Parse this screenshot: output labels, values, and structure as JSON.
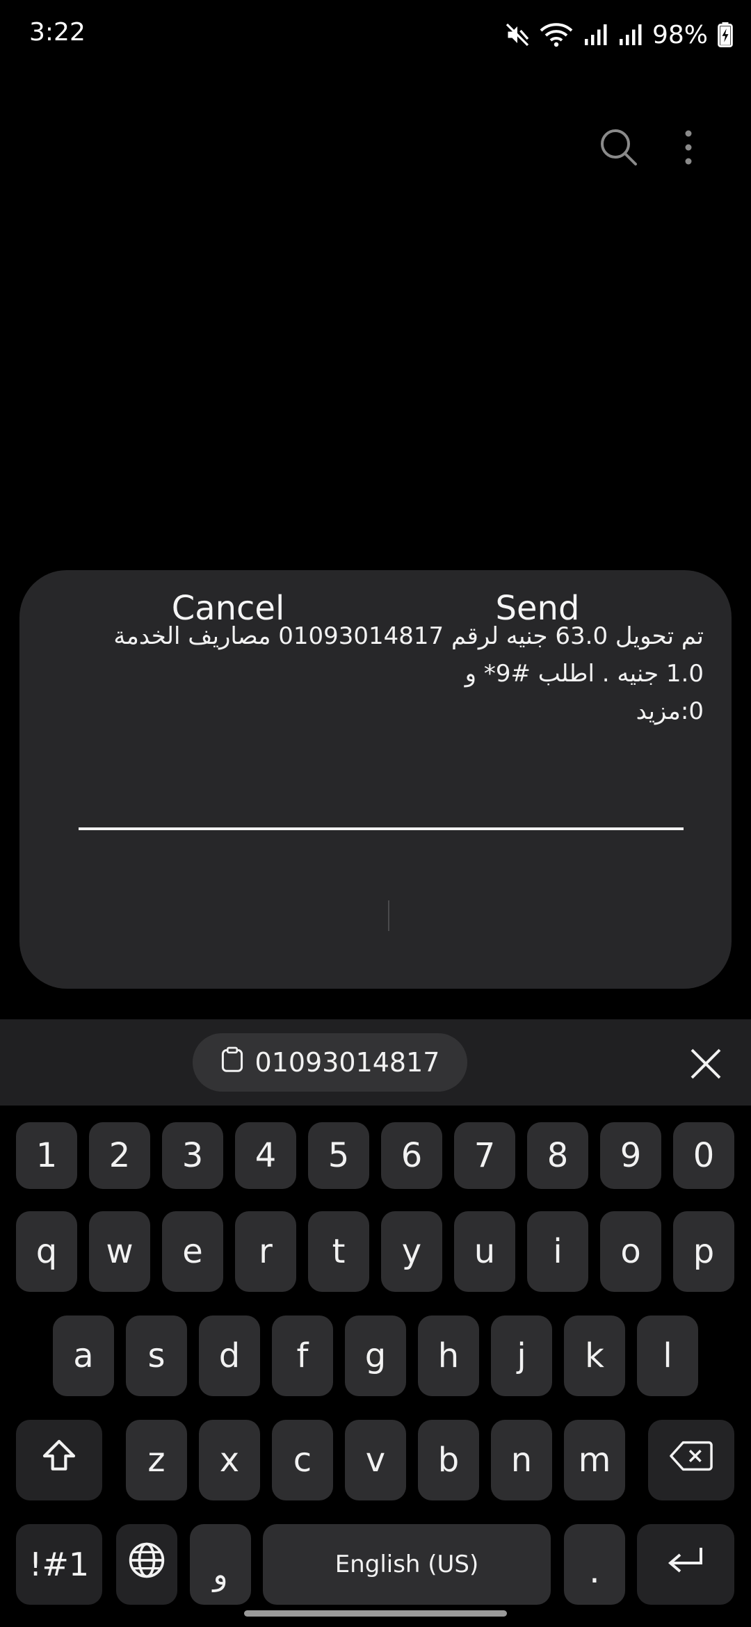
{
  "status_bar": {
    "time": "3:22",
    "battery": "98%",
    "icons": [
      "mute-icon",
      "wifi-icon",
      "signal-icon",
      "signal-icon",
      "battery-charging-icon"
    ]
  },
  "app_bar": {
    "icons": [
      "search-icon",
      "more-vertical-icon"
    ]
  },
  "dialog": {
    "message": "تم تحويل 63.0 جنيه لرقم 01093014817 مصاريف الخدمة 1.0 جنيه . اطلب #9* و\n0:مزيد",
    "cancel_label": "Cancel",
    "send_label": "Send"
  },
  "keyboard": {
    "clipboard_text": "01093014817",
    "number_row": [
      "1",
      "2",
      "3",
      "4",
      "5",
      "6",
      "7",
      "8",
      "9",
      "0"
    ],
    "row1": [
      "q",
      "w",
      "e",
      "r",
      "t",
      "y",
      "u",
      "i",
      "o",
      "p"
    ],
    "row2": [
      "a",
      "s",
      "d",
      "f",
      "g",
      "h",
      "j",
      "k",
      "l"
    ],
    "row3": [
      "z",
      "x",
      "c",
      "v",
      "b",
      "n",
      "m"
    ],
    "symbols_label": "!#1",
    "comma_label": "و",
    "space_label": "English (US)",
    "period_label": "."
  }
}
